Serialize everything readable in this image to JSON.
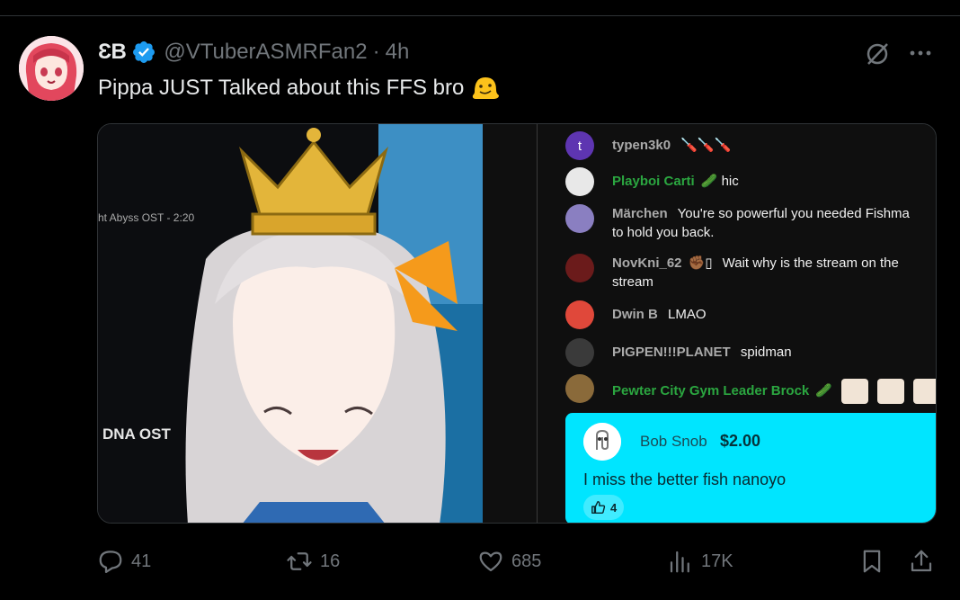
{
  "post": {
    "display_name": "ƐB",
    "handle": "@VTuberASMRFan2",
    "separator": "·",
    "time": "4h",
    "text": "Pippa JUST Talked about this FFS bro"
  },
  "media": {
    "art_label_ost": "ht Abyss OST - 2:20",
    "art_label_dna": "DNA OST",
    "chat": [
      {
        "author": "typen3k0",
        "text": "",
        "member": false,
        "avatar_color": "#5e35b1",
        "avatar_letter": "t",
        "badge": "🪛🪛🪛"
      },
      {
        "author": "Playboi Carti",
        "text": "hic",
        "member": true,
        "avatar_color": "#e8e8e8",
        "badge": "🥒"
      },
      {
        "author": "Märchen",
        "text": "You're so powerful you needed Fishma",
        "text2": "to hold you back.",
        "member": false,
        "avatar_color": "#8a7fc1"
      },
      {
        "author": "NovKni_62",
        "text": "Wait why is the stream on the",
        "text2": "stream",
        "member": false,
        "avatar_color": "#6b1b1b",
        "badge": "✊🏾▯"
      },
      {
        "author": "Dwin B",
        "text": "LMAO",
        "member": false,
        "avatar_color": "#e0483a"
      },
      {
        "author": "PIGPEN!!!PLANET",
        "text": "spidman",
        "member": false,
        "avatar_color": "#3a3a3a"
      },
      {
        "author": "Pewter City Gym Leader Brock",
        "text": "",
        "member": true,
        "avatar_color": "#8a6a3a",
        "badge": "🥒"
      }
    ],
    "superchat": {
      "name": "Bob Snob",
      "amount": "$2.00",
      "text": "I miss the better fish nanoyo",
      "likes": "4"
    }
  },
  "actions": {
    "replies": "41",
    "reposts": "16",
    "likes": "685",
    "views": "17K"
  },
  "colors": {
    "verified": "#1d9bf0",
    "superchat_bg": "#00e5ff",
    "member_green": "#2ba640",
    "muted": "#71767b"
  },
  "icons": [
    "verified-badge-icon",
    "grok-icon",
    "more-icon",
    "reply-icon",
    "repost-icon",
    "like-icon",
    "views-icon",
    "bookmark-icon",
    "share-icon",
    "melting-face-emoji-icon",
    "thumbs-up-icon"
  ]
}
